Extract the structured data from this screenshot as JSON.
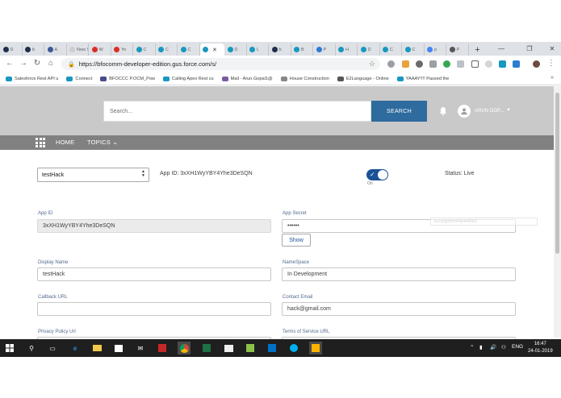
{
  "browser": {
    "tabs": [
      {
        "label": "D",
        "color": "#1f2f4a"
      },
      {
        "label": "b",
        "color": "#1f2f4a"
      },
      {
        "label": "A",
        "color": "#3b5998"
      },
      {
        "label": "New S",
        "color": "#cccccc"
      },
      {
        "label": "W",
        "color": "#d93025"
      },
      {
        "label": "Yo",
        "color": "#d93025"
      },
      {
        "label": "C",
        "color": "#1798c1"
      },
      {
        "label": "C",
        "color": "#1798c1"
      },
      {
        "label": "C",
        "color": "#1798c1"
      },
      {
        "label": "",
        "color": "#1798c1"
      },
      {
        "label": "D",
        "color": "#1798c1"
      },
      {
        "label": "L",
        "color": "#1798c1"
      },
      {
        "label": "b",
        "color": "#1f2f4a"
      },
      {
        "label": "B",
        "color": "#1798c1"
      },
      {
        "label": "P",
        "color": "#2b7cd3"
      },
      {
        "label": "H",
        "color": "#1798c1"
      },
      {
        "label": "D",
        "color": "#1798c1"
      },
      {
        "label": "C",
        "color": "#1798c1"
      },
      {
        "label": "C",
        "color": "#1798c1"
      },
      {
        "label": "p",
        "color": "#4285f4"
      },
      {
        "label": "P",
        "color": "#555555"
      }
    ],
    "active_tab_index": 9,
    "url": "https://bfocomm-developer-edition.gus.force.com/s/",
    "bookmarks": [
      {
        "label": "Salesforce Rest API u",
        "color": "#1798c1"
      },
      {
        "label": "Connect",
        "color": "#1798c1"
      },
      {
        "label": "BFOCCC P.OCM_Pow",
        "color": "#4a4a8c"
      },
      {
        "label": "Calling Apex Rest cu",
        "color": "#1798c1"
      },
      {
        "label": "Mail - Arun.Gopal1@",
        "color": "#7a5ba3"
      },
      {
        "label": "House Construction",
        "color": "#888888"
      },
      {
        "label": "E2Language - Online",
        "color": "#555555"
      },
      {
        "label": "YAAAY!!!! Passed the",
        "color": "#1798c1"
      }
    ],
    "bookmarks_more": "»"
  },
  "site": {
    "search_placeholder": "Search...",
    "search_button": "SEARCH",
    "user_name": "ARUN GOP...",
    "nav": {
      "home": "HOME",
      "topics": "TOPICS"
    }
  },
  "form": {
    "app_select_value": "testHack",
    "app_id_line": "App ID: 3xXH1WyYBY4Yhe3DeSQN",
    "toggle_label": "On",
    "status_line": "Status: Live",
    "app_id_label": "App ID",
    "app_id_value": "3xXH1WyYBY4Yhe3DeSQN",
    "app_secret_label": "App Secret",
    "app_secret_value": "••••••",
    "show_button": "Show",
    "ghost_tooltip": "1o2q3gx8mnv6jx4e89c2",
    "display_name_label": "Display Name",
    "display_name_value": "testHack",
    "namespace_label": "NameSpace",
    "namespace_value": "In Development",
    "callback_url_label": "Callback URL",
    "callback_url_value": "",
    "contact_email_label": "Contact Email",
    "contact_email_value": "hack@gmail.com",
    "privacy_policy_label": "Privacy Policy Url",
    "terms_label": "Terms of Service URL"
  },
  "taskbar": {
    "language": "ENG",
    "time": "16:47",
    "date": "24-01-2019"
  },
  "colors": {
    "search_button": "#2e6b9e",
    "toggle_on": "#1b5297",
    "nav_bar": "#818181",
    "hero": "#c9c9c9"
  }
}
